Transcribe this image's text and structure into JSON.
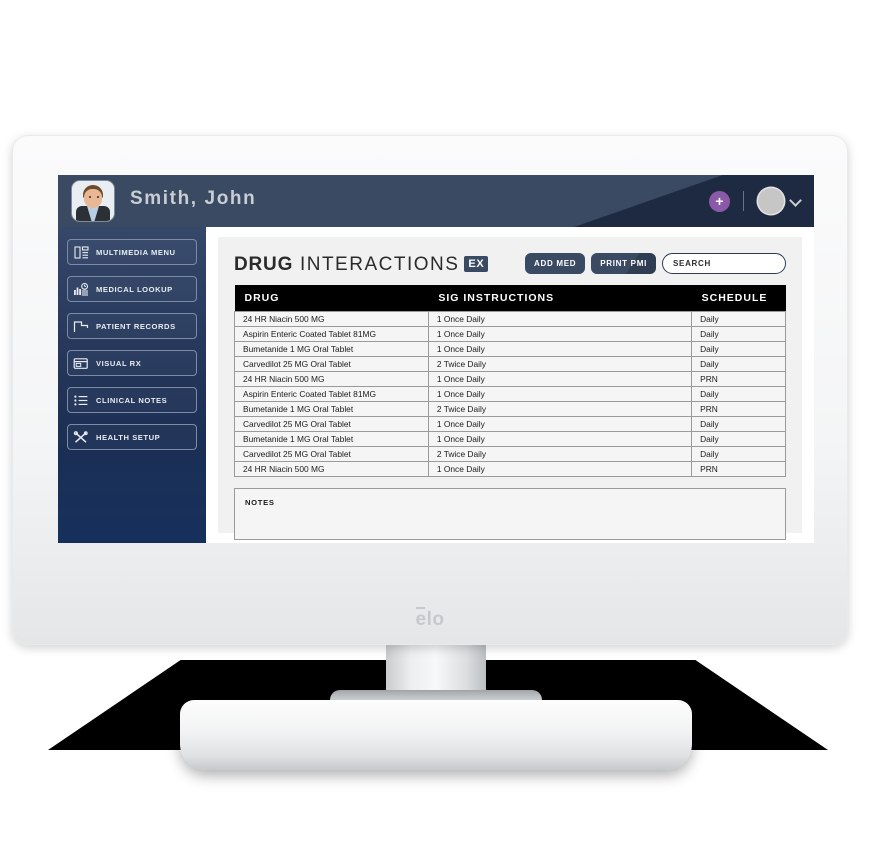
{
  "device": {
    "brand_logo": "elo"
  },
  "appbar": {
    "patient_name": "Smith, John",
    "add_button_label": "+",
    "avatar_icon": "user-avatar",
    "caret_icon": "chevron-down-icon",
    "bg_color": "#3a4a63",
    "accent_purple": "#8a5aa8"
  },
  "sidebar": {
    "bg_gradient_top": "#35486a",
    "bg_gradient_bottom": "#16305c",
    "items": [
      {
        "label": "MULTIMEDIA MENU",
        "icon": "multimedia-layout-icon"
      },
      {
        "label": "MEDICAL LOOKUP",
        "icon": "bar-chart-clock-icon"
      },
      {
        "label": "PATIENT RECORDS",
        "icon": "flag-folder-icon"
      },
      {
        "label": "VISUAL RX",
        "icon": "window-icon"
      },
      {
        "label": "CLINICAL NOTES",
        "icon": "list-icon"
      },
      {
        "label": "HEALTH SETUP",
        "icon": "tools-icon"
      }
    ]
  },
  "main": {
    "title_bold": "DRUG",
    "title_light": "INTERACTIONS",
    "title_badge": "EX",
    "buttons": [
      {
        "label": "ADD MED"
      },
      {
        "label": "PRINT PMI"
      }
    ],
    "search": {
      "placeholder": "SEARCH",
      "value": ""
    },
    "table": {
      "columns": [
        "DRUG",
        "SIG INSTRUCTIONS",
        "SCHEDULE"
      ],
      "rows": [
        [
          "24 HR Niacin 500 MG",
          "1 Once Daily",
          "Daily"
        ],
        [
          "Aspirin Enteric Coated Tablet 81MG",
          "1 Once Daily",
          "Daily"
        ],
        [
          "Bumetanide 1 MG Oral Tablet",
          "1 Once Daily",
          "Daily"
        ],
        [
          "Carvedilot 25 MG Oral Tablet",
          "2 Twice Daily",
          "Daily"
        ],
        [
          "24 HR Niacin 500 MG",
          "1 Once Daily",
          "PRN"
        ],
        [
          "Aspirin Enteric Coated Tablet 81MG",
          "1 Once Daily",
          "Daily"
        ],
        [
          "Bumetanide 1 MG Oral Tablet",
          "2 Twice Daily",
          "PRN"
        ],
        [
          "Carvedilot 25 MG Oral Tablet",
          "1 Once Daily",
          "Daily"
        ],
        [
          "Bumetanide 1 MG Oral Tablet",
          "1 Once Daily",
          "Daily"
        ],
        [
          "Carvedilot 25 MG Oral Tablet",
          "2 Twice Daily",
          "Daily"
        ],
        [
          "24 HR Niacin 500 MG",
          "1 Once Daily",
          "PRN"
        ]
      ]
    },
    "notes": {
      "label": "NOTES",
      "value": ""
    }
  }
}
